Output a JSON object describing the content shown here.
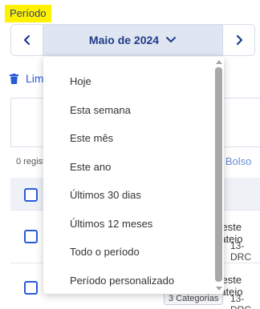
{
  "filter": {
    "label": "Período"
  },
  "period_nav": {
    "selected": "Maio de 2024"
  },
  "clear": {
    "label": "Limpar filtros"
  },
  "records": {
    "label": "0 registros"
  },
  "bolso": {
    "label": "e Bolso"
  },
  "rows": [
    {
      "title": "Teste rateio",
      "code": "13-DRC"
    },
    {
      "title": "Teste rateio",
      "code": "13-DRC",
      "badge": "3 Categorias"
    }
  ],
  "dropdown": {
    "options": [
      "Hoje",
      "Esta semana",
      "Este mês",
      "Este ano",
      "Últimos 30 dias",
      "Últimos 12 meses",
      "Todo o período",
      "Período personalizado"
    ]
  },
  "colors": {
    "accent": "#1f3b8c",
    "highlight": "#fff200",
    "link": "#2a5bd7",
    "select_bg": "#dfe5f1"
  },
  "icons": {
    "prev": "chevron-left-icon",
    "next": "chevron-right-icon",
    "caret": "chevron-down-icon",
    "clear": "trash-icon"
  }
}
